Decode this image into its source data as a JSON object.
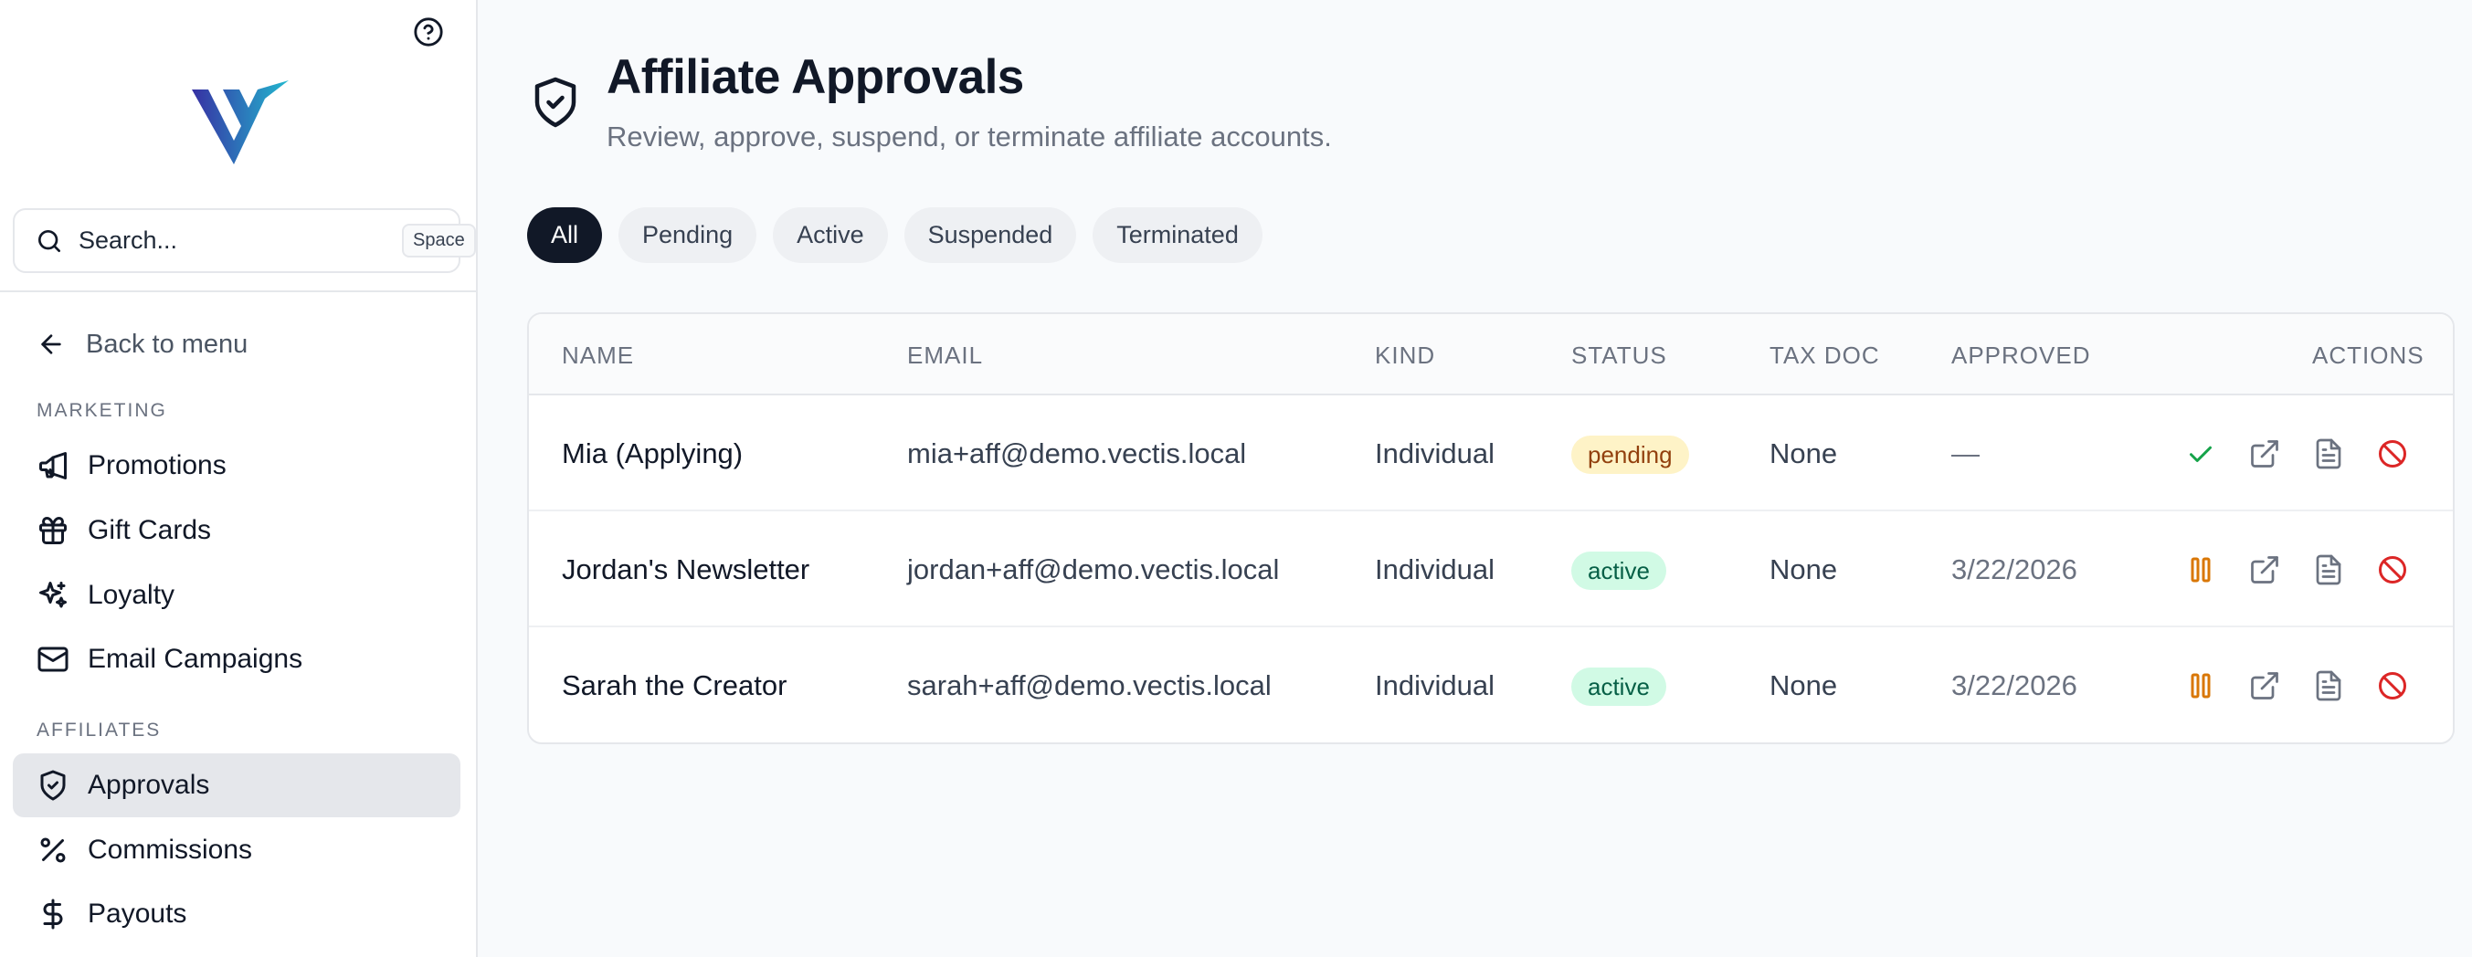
{
  "sidebar": {
    "search": {
      "placeholder": "Search...",
      "shortcut": "Space"
    },
    "back_label": "Back to menu",
    "sections": [
      {
        "label": "MARKETING",
        "items": [
          {
            "label": "Promotions",
            "icon": "megaphone-icon"
          },
          {
            "label": "Gift Cards",
            "icon": "gift-icon"
          },
          {
            "label": "Loyalty",
            "icon": "sparkles-icon"
          },
          {
            "label": "Email Campaigns",
            "icon": "mail-icon"
          }
        ]
      },
      {
        "label": "AFFILIATES",
        "items": [
          {
            "label": "Approvals",
            "icon": "shield-check-icon",
            "active": true
          },
          {
            "label": "Commissions",
            "icon": "percent-icon"
          },
          {
            "label": "Payouts",
            "icon": "dollar-icon"
          }
        ]
      }
    ]
  },
  "page": {
    "title": "Affiliate Approvals",
    "subtitle": "Review, approve, suspend, or terminate affiliate accounts."
  },
  "filters": [
    {
      "label": "All",
      "active": true
    },
    {
      "label": "Pending"
    },
    {
      "label": "Active"
    },
    {
      "label": "Suspended"
    },
    {
      "label": "Terminated"
    }
  ],
  "table": {
    "columns": [
      "NAME",
      "EMAIL",
      "KIND",
      "STATUS",
      "TAX DOC",
      "APPROVED",
      "ACTIONS"
    ],
    "rows": [
      {
        "name": "Mia (Applying)",
        "email": "mia+aff@demo.vectis.local",
        "kind": "Individual",
        "status": "pending",
        "tax_doc": "None",
        "approved": "—",
        "primary_action": "approve-icon"
      },
      {
        "name": "Jordan's Newsletter",
        "email": "jordan+aff@demo.vectis.local",
        "kind": "Individual",
        "status": "active",
        "tax_doc": "None",
        "approved": "3/22/2026",
        "primary_action": "pause-icon"
      },
      {
        "name": "Sarah the Creator",
        "email": "sarah+aff@demo.vectis.local",
        "kind": "Individual",
        "status": "active",
        "tax_doc": "None",
        "approved": "3/22/2026",
        "primary_action": "pause-icon"
      }
    ]
  },
  "colors": {
    "approve": "#16a34a",
    "pause": "#d97706",
    "terminate": "#dc2626",
    "icon_gray": "#6b7280",
    "logo_dark": "#3730a3",
    "logo_light": "#22b8cf"
  }
}
